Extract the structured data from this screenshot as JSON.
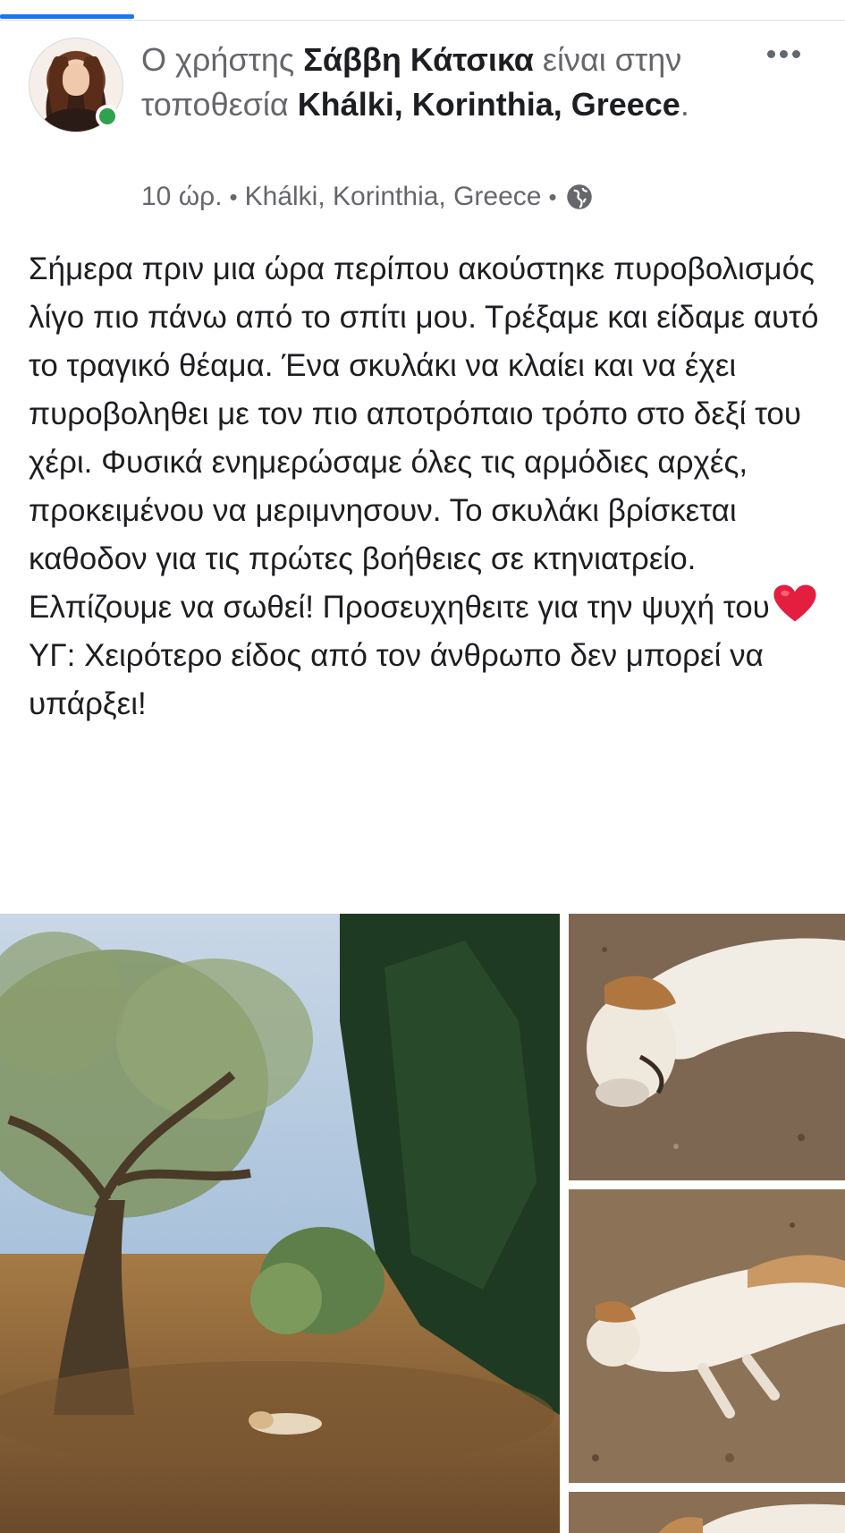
{
  "post": {
    "header": {
      "prefix": "Ο χρήστης ",
      "user_name": "Σάββη Κάτσικα",
      "middle": " είναι στην τοποθεσία ",
      "location": "Khálki, Korinthia, Greece",
      "suffix": "."
    },
    "meta": {
      "time": "10 ώρ.",
      "separator": "•",
      "location": "Khálki, Korinthia, Greece",
      "privacy_icon": "globe-icon"
    },
    "more_icon": "more-options-icon",
    "body_text": "Σήμερα πριν μια ώρα περίπου ακούστηκε πυροβολισμός λίγο πιο πάνω από το σπίτι μου. Τρέξαμε και είδαμε αυτό το τραγικό θέαμα. Ένα σκυλάκι να κλαίει και να έχει πυροβοληθει με τον πιο αποτρόπαιο τρόπο στο δεξί του χέρι. Φυσικά ενημερώσαμε όλες τις αρμόδιες αρχές, προκειμένου να μεριμνησουν. Το σκυλάκι βρίσκεται καθοδον για τις πρώτες βοήθειες σε κτηνιατρείο. Ελπίζουμε να σωθεί! Προσευχηθειτε για την ψυχή του",
    "body_emoji": "heart-icon",
    "body_ps": "ΥΓ: Χειρότερο είδος από τον άνθρωπο δεν μπορεί να υπάρξει!",
    "presence_color": "#31a24c",
    "photos": [
      "olive-grove-photo",
      "dog-closeup-photo",
      "dog-lying-photo",
      "dog-partial-photo"
    ]
  }
}
